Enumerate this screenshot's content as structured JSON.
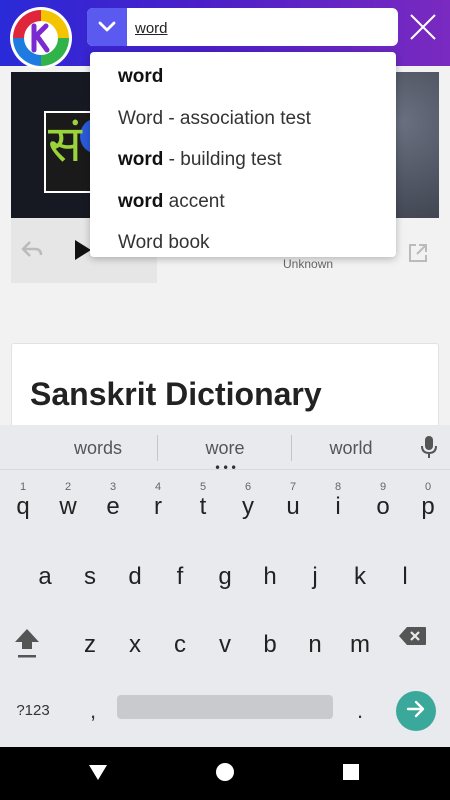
{
  "search": {
    "value": "word",
    "placeholder": ""
  },
  "suggestions": [
    {
      "bold": "word",
      "rest": ""
    },
    {
      "bold": "",
      "rest": "Word - association test"
    },
    {
      "bold": "word",
      "rest": " - building test"
    },
    {
      "bold": "word",
      "rest": " accent"
    },
    {
      "bold": "",
      "rest": "Word book"
    }
  ],
  "player": {
    "artist": "Unknown"
  },
  "card": {
    "title": "Sanskrit Dictionary"
  },
  "hero_logo_text": "सं",
  "keyboard": {
    "strip": [
      "words",
      "wore",
      "world"
    ],
    "row1": [
      {
        "ch": "q",
        "hint": "1"
      },
      {
        "ch": "w",
        "hint": "2"
      },
      {
        "ch": "e",
        "hint": "3"
      },
      {
        "ch": "r",
        "hint": "4"
      },
      {
        "ch": "t",
        "hint": "5"
      },
      {
        "ch": "y",
        "hint": "6"
      },
      {
        "ch": "u",
        "hint": "7"
      },
      {
        "ch": "i",
        "hint": "8"
      },
      {
        "ch": "o",
        "hint": "9"
      },
      {
        "ch": "p",
        "hint": "0"
      }
    ],
    "row2": [
      "a",
      "s",
      "d",
      "f",
      "g",
      "h",
      "j",
      "k",
      "l"
    ],
    "row3": [
      "z",
      "x",
      "c",
      "v",
      "b",
      "n",
      "m"
    ],
    "symbols_label": "?123",
    "comma": ",",
    "period": "."
  },
  "colors": {
    "topbar_start": "#2a2ad8",
    "topbar_end": "#7a2ac0",
    "enter_key": "#3aa89b",
    "dropdown_button": "#5a5af0"
  }
}
